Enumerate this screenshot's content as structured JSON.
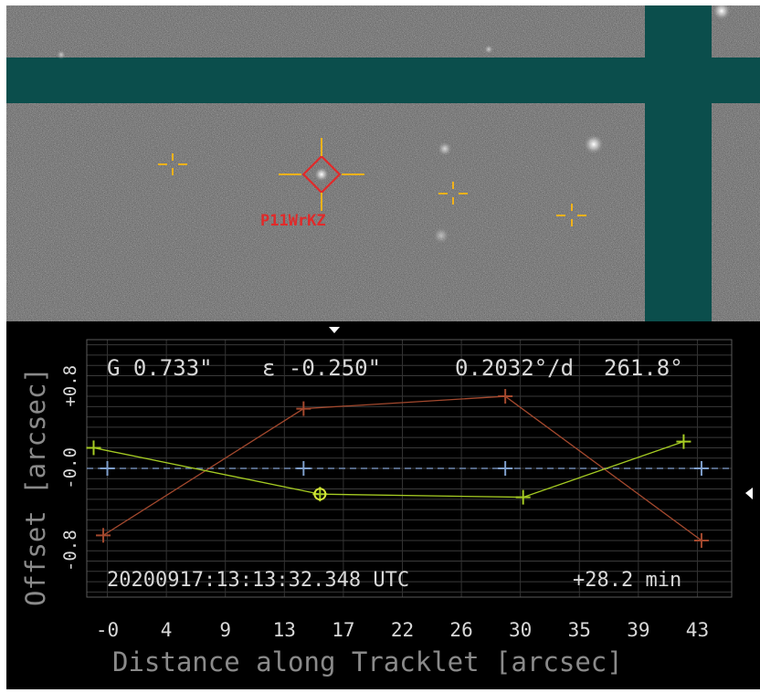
{
  "image_viewer": {
    "object_label": "P11WrKZ",
    "colors": {
      "mask": "#0b4e4c",
      "target": "#e12a2a",
      "crosshair": "#f2b21b"
    }
  },
  "residual_plot": {
    "stats": {
      "g_value": "G 0.733\"",
      "epsilon_value": "ε -0.250\"",
      "rate": "0.2032°/d",
      "angle": "261.8°"
    },
    "timestamp": "20200917:13:13:32.348 UTC",
    "elapsed": "+28.2 min",
    "y_axis_label": "Offset [arcsec]",
    "x_axis_label": "Distance along Tracklet [arcsec]",
    "markers": {
      "top_marker": "down-triangle-icon",
      "right_marker": "left-triangle-icon"
    }
  },
  "chart_data": {
    "type": "line",
    "x_ticks": [
      "-0",
      "4",
      "9",
      "13",
      "17",
      "22",
      "26",
      "30",
      "35",
      "39",
      "43"
    ],
    "x_tick_values": [
      0,
      4.3,
      8.6,
      12.9,
      17.2,
      21.5,
      25.8,
      30.1,
      34.4,
      38.7,
      43.0
    ],
    "y_ticks": [
      "+0.8",
      "-0.0",
      "-0.8"
    ],
    "y_tick_values": [
      0.8,
      0,
      -0.8
    ],
    "xlim": [
      -1.5,
      45.5
    ],
    "ylim": [
      -1.25,
      1.25
    ],
    "grid": true,
    "series": [
      {
        "color": "#a4492e",
        "points": [
          [
            -0.3,
            -0.65
          ],
          [
            14.3,
            0.58
          ],
          [
            29.0,
            0.7
          ],
          [
            43.3,
            -0.7
          ]
        ]
      },
      {
        "color": "#a6cc23",
        "points": [
          [
            -1.0,
            0.2
          ],
          [
            15.5,
            -0.25
          ],
          [
            30.3,
            -0.28
          ],
          [
            42.0,
            0.26
          ]
        ]
      },
      {
        "color": "#7f9fcc",
        "points": [
          [
            0.0,
            0.0
          ],
          [
            14.3,
            0.0
          ],
          [
            29.0,
            0.0
          ],
          [
            43.3,
            0.0
          ]
        ]
      }
    ],
    "highlight_point": [
      15.5,
      -0.25
    ],
    "zero_line": 0
  }
}
